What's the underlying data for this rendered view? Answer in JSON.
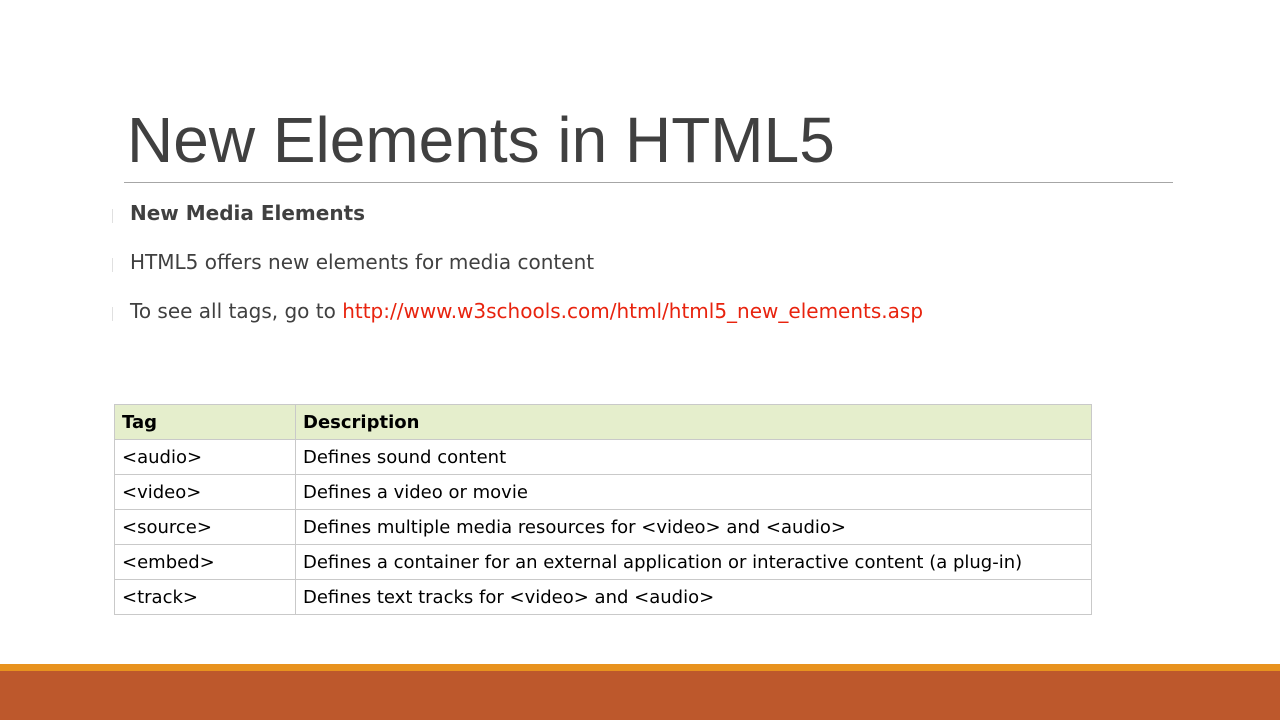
{
  "slide": {
    "title": "New Elements in HTML5",
    "bullets": [
      {
        "text": "New Media Elements",
        "bold": true
      },
      {
        "text": "HTML5 offers new elements for media content",
        "bold": false
      },
      {
        "text": "To see all tags, go to ",
        "link": "http://www.w3schools.com/html/html5_new_elements.asp",
        "bold": false
      }
    ]
  },
  "table": {
    "headers": [
      "Tag",
      "Description"
    ],
    "rows": [
      [
        "<audio>",
        "Defines sound content"
      ],
      [
        "<video>",
        "Defines a video or movie"
      ],
      [
        "<source>",
        "Defines multiple media resources for <video> and <audio>"
      ],
      [
        "<embed>",
        "Defines a container for an external application or interactive content (a plug-in)"
      ],
      [
        "<track>",
        "Defines text tracks for <video> and <audio>"
      ]
    ]
  },
  "colors": {
    "title_text": "#404040",
    "link": "#e8230e",
    "table_header_bg": "#e5eecc",
    "footer_accent": "#e8921e",
    "footer_bar": "#bd582c"
  }
}
